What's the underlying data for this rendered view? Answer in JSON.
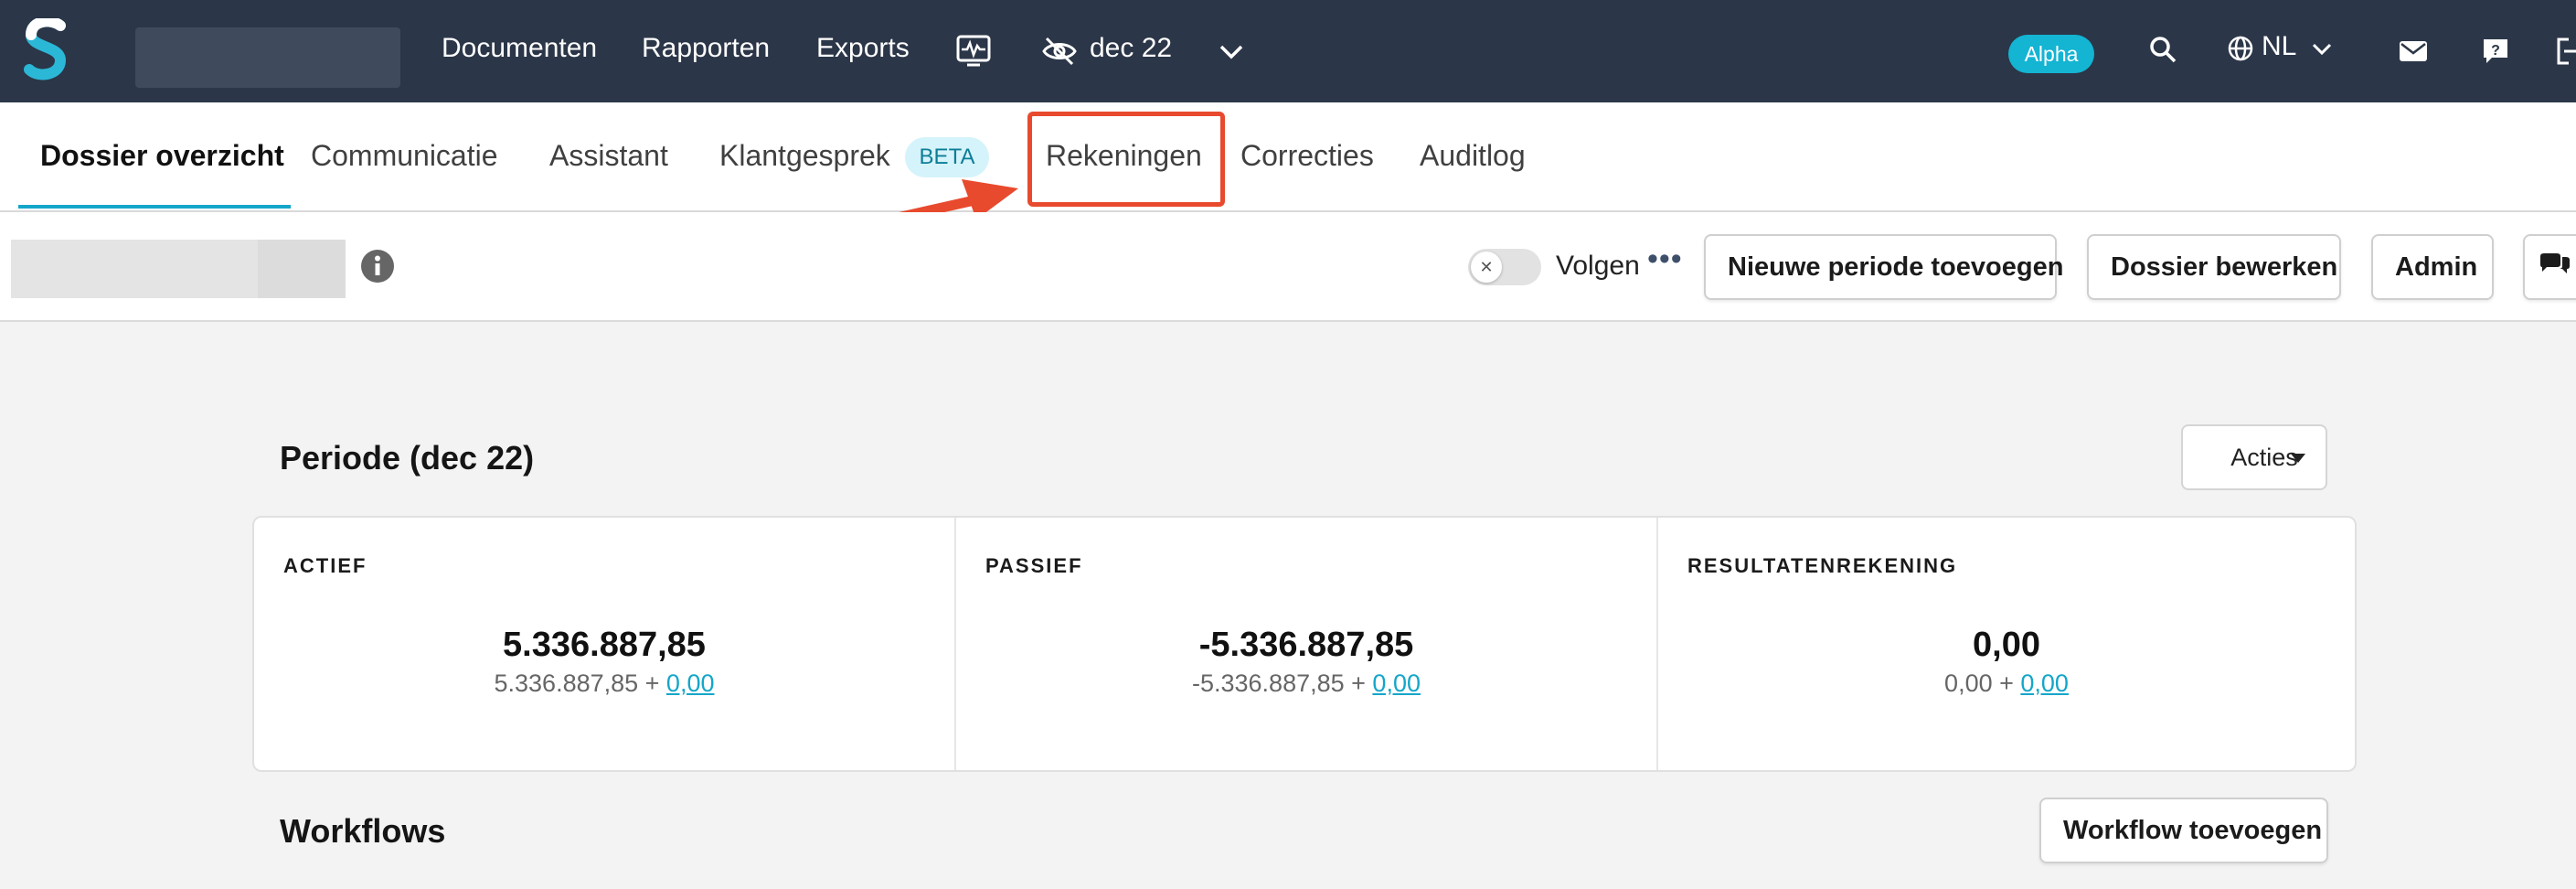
{
  "topnav": {
    "links": [
      "Documenten",
      "Rapporten",
      "Exports"
    ],
    "period": "dec 22",
    "alpha_badge": "Alpha",
    "language": "NL",
    "icons": [
      "logo-s-icon",
      "activity-icon",
      "eye-off-icon",
      "chevron-down-icon",
      "search-icon",
      "globe-icon",
      "mail-icon",
      "help-icon",
      "logout-icon"
    ]
  },
  "tabs": {
    "items": [
      "Dossier overzicht",
      "Communicatie",
      "Assistant",
      "Klantgesprek",
      "Rekeningen",
      "Correcties",
      "Auditlog"
    ],
    "beta_badge": "BETA",
    "active": "Dossier overzicht",
    "highlighted": "Rekeningen"
  },
  "actionbar": {
    "follow_label": "Volgen",
    "more_label": "•••",
    "buttons": {
      "new_period": "Nieuwe periode toevoegen",
      "edit_dossier": "Dossier bewerken",
      "admin": "Admin"
    }
  },
  "period_section": {
    "title": "Periode (dec 22)",
    "actions_label": "Acties",
    "columns": [
      {
        "heading": "ACTIEF",
        "total": "5.336.887,85",
        "base": "5.336.887,85 + ",
        "correction": "0,00"
      },
      {
        "heading": "PASSIEF",
        "total": "-5.336.887,85",
        "base": "-5.336.887,85 + ",
        "correction": "0,00"
      },
      {
        "heading": "RESULTATENREKENING",
        "total": "0,00",
        "base": "0,00 + ",
        "correction": "0,00"
      }
    ]
  },
  "workflows": {
    "title": "Workflows",
    "add_label": "Workflow toevoegen"
  },
  "colors": {
    "nav_bg": "#2b3648",
    "accent": "#14a6c9",
    "highlight": "#e84a2e"
  }
}
